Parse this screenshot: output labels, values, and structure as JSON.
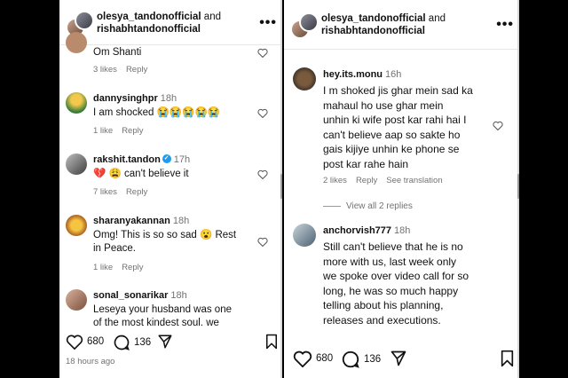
{
  "left": {
    "header": {
      "user1": "olesya_tandonofficial",
      "and": "and",
      "user2": "rishabhtandonofficial"
    },
    "comments": [
      {
        "text": "Om Shanti",
        "likes": "3 likes",
        "reply": "Reply"
      },
      {
        "user": "dannysinghpr",
        "time": "18h",
        "text": "I am shocked 😭😭😭😭😭",
        "likes": "1 like",
        "reply": "Reply"
      },
      {
        "user": "rakshit.tandon",
        "time": "17h",
        "text": "💔 😩 can't believe it",
        "likes": "7 likes",
        "reply": "Reply"
      },
      {
        "user": "sharanyakannan",
        "time": "18h",
        "text_l1": "Omg! This is so so sad 😮 Rest",
        "text_l2": "in Peace.",
        "likes": "1 like",
        "reply": "Reply"
      },
      {
        "user": "sonal_sonarikar",
        "time": "18h",
        "text_l1": "Leseya your husband was one",
        "text_l2": "of the most kindest soul. we"
      }
    ],
    "footer": {
      "likes": "680",
      "comments": "136",
      "timestamp": "18 hours ago"
    }
  },
  "right": {
    "header": {
      "user1": "olesya_tandonofficial",
      "and": "and",
      "user2": "rishabhtandonofficial"
    },
    "comments": [
      {
        "user": "hey.its.monu",
        "time": "16h",
        "lines": [
          "I m shoked jis ghar mein sad ka",
          "mahaul ho use ghar mein",
          "unhin ki wife post kar rahi hai I",
          "can't believe aap so sakte ho",
          "gais kijiye unhin ke phone se",
          "post kar rahe hain"
        ],
        "likes": "2 likes",
        "reply": "Reply",
        "translation": "See translation"
      },
      {
        "user": "anchorvish777",
        "time": "18h",
        "lines": [
          "Still can't believe that he is no",
          "more with us, last week only",
          "we spoke over video call for so",
          "long, he was so much happy",
          "telling about his planning,",
          "releases and executions."
        ]
      }
    ],
    "view_replies": "View all 2 replies",
    "footer": {
      "likes": "680",
      "comments": "136"
    }
  },
  "colors": {
    "meta_gray": "#737373",
    "verified_blue": "#1d9bf0",
    "background": "#000000"
  }
}
